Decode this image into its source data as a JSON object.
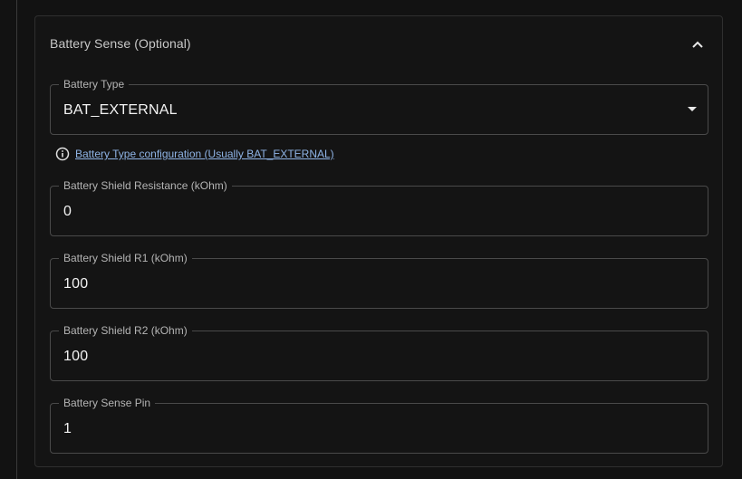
{
  "section": {
    "title": "Battery Sense (Optional)",
    "collapse_icon": "chevron-up-icon"
  },
  "battery_type": {
    "label": "Battery Type",
    "value": "BAT_EXTERNAL",
    "dropdown_icon": "caret-down-icon",
    "helper_icon": "info-icon",
    "helper_link": "Battery Type configuration (Usually BAT_EXTERNAL)"
  },
  "shield_resistance": {
    "label": "Battery Shield Resistance (kOhm)",
    "value": "0"
  },
  "shield_r1": {
    "label": "Battery Shield R1 (kOhm)",
    "value": "100"
  },
  "shield_r2": {
    "label": "Battery Shield R2 (kOhm)",
    "value": "100"
  },
  "sense_pin": {
    "label": "Battery Sense Pin",
    "value": "1"
  },
  "colors": {
    "background": "#121212",
    "border": "#4a4a4a",
    "link": "#8fb4e6"
  }
}
